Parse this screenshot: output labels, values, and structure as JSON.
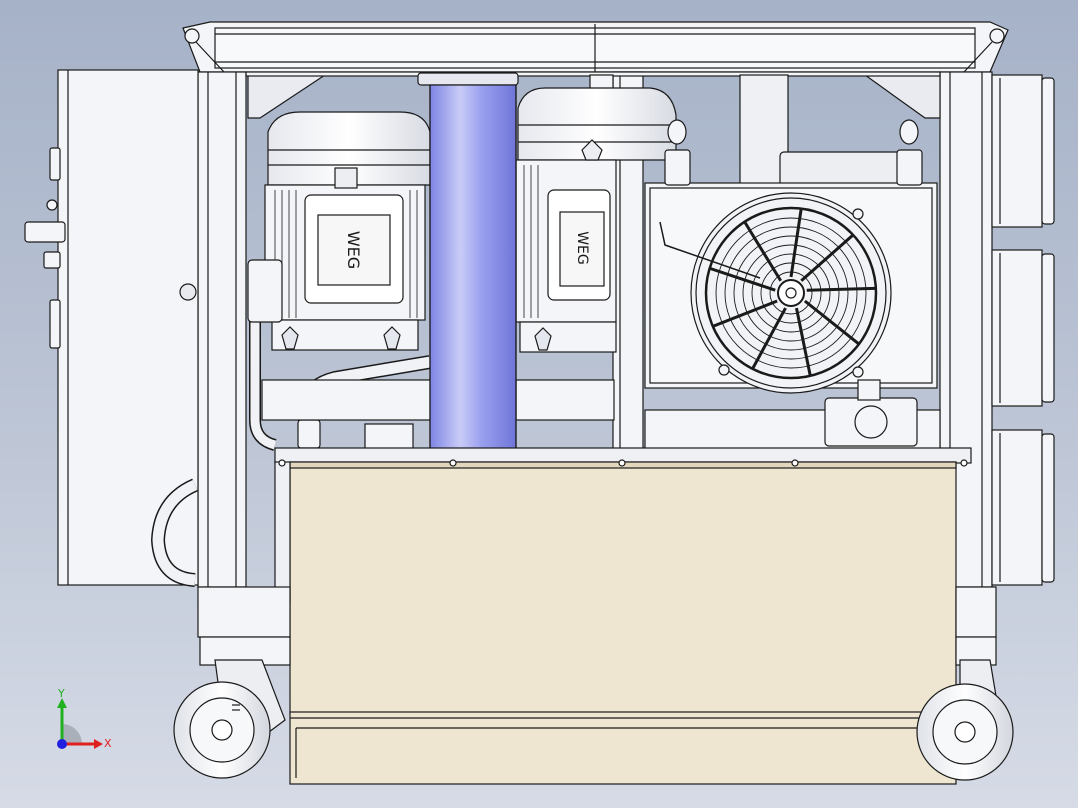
{
  "view": {
    "type": "3d-cad-assembly-front-view",
    "background_top": "#a6b2c8",
    "background_bottom": "#d6dbe6"
  },
  "colors": {
    "line": "#1a1a1a",
    "metal": "#f4f5f8",
    "metal_shade": "#dcdfe6",
    "tank": "#efe6d1",
    "tank_shade": "#e2d7bd",
    "filter_tube": "#8c92ea",
    "filter_tube_light": "#c9ccf7",
    "axis_x": "#e02020",
    "axis_y": "#20b020",
    "axis_z": "#2020e0"
  },
  "motors": [
    {
      "name": "motor-left",
      "logo": "WEG"
    },
    {
      "name": "motor-right",
      "logo": "WEG"
    }
  ],
  "cooler": {
    "name": "fan-cooler",
    "blades": 9
  },
  "triad": {
    "x_label": "X",
    "y_label": "Y"
  }
}
